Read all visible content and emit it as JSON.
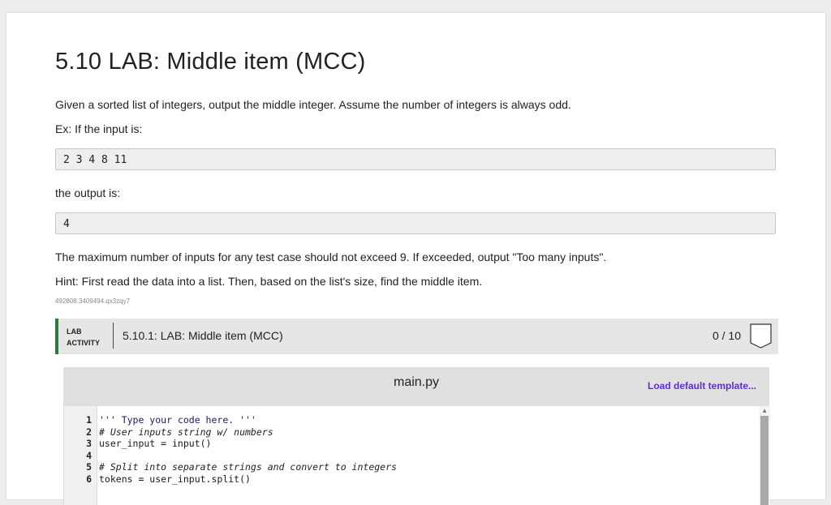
{
  "page": {
    "title": "5.10 LAB: Middle item (MCC)",
    "intro": "Given a sorted list of integers, output the middle integer. Assume the number of integers is always odd.",
    "example_label": "Ex: If the input is:",
    "example_input": "2 3 4 8 11",
    "output_label": "the output is:",
    "example_output": "4",
    "limit_text": "The maximum number of inputs for any test case should not exceed 9. If exceeded, output \"Too many inputs\".",
    "hint_text": "Hint: First read the data into a list. Then, based on the list's size, find the middle item.",
    "tag": "492808.3409494.qx3zqy7"
  },
  "activity": {
    "label_line1": "LAB",
    "label_line2": "ACTIVITY",
    "title": "5.10.1: LAB: Middle item (MCC)",
    "score": "0 / 10",
    "accent_color": "#2c7a3f"
  },
  "editor": {
    "filename": "main.py",
    "load_template": "Load default template...",
    "link_color": "#5b2fd6",
    "lines": [
      {
        "num": "1",
        "text": "''' Type your code here. '''"
      },
      {
        "num": "2",
        "text": "# User inputs string w/ numbers"
      },
      {
        "num": "3",
        "text": "user_input = input()"
      },
      {
        "num": "4",
        "text": ""
      },
      {
        "num": "5",
        "text": "# Split into separate strings and convert to integers"
      },
      {
        "num": "6",
        "text": "tokens = user_input.split()"
      }
    ]
  }
}
